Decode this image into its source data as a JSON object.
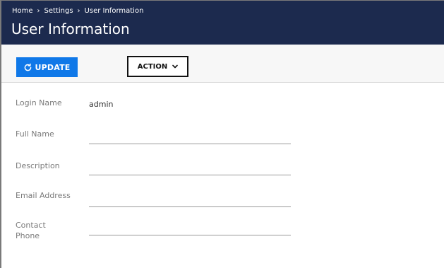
{
  "breadcrumb": {
    "items": [
      "Home",
      "Settings",
      "User Information"
    ],
    "separator": "›"
  },
  "page": {
    "title": "User Information"
  },
  "toolbar": {
    "update_label": "UPDATE",
    "update_icon": "refresh-icon",
    "action_label": "ACTION",
    "action_icon": "chevron-down-icon"
  },
  "form": {
    "login_name": {
      "label": "Login Name",
      "value": "admin"
    },
    "full_name": {
      "label": "Full Name",
      "value": ""
    },
    "description": {
      "label": "Description",
      "value": ""
    },
    "email": {
      "label": "Email Address",
      "value": ""
    },
    "contact_phone": {
      "label_line1": "Contact",
      "label_line2": "Phone",
      "value": ""
    }
  },
  "colors": {
    "header_bg": "#1c2a4e",
    "update_button": "#0f78e8",
    "toolbar_bg": "#f7f7f7",
    "label_text": "#7a7a7a"
  }
}
